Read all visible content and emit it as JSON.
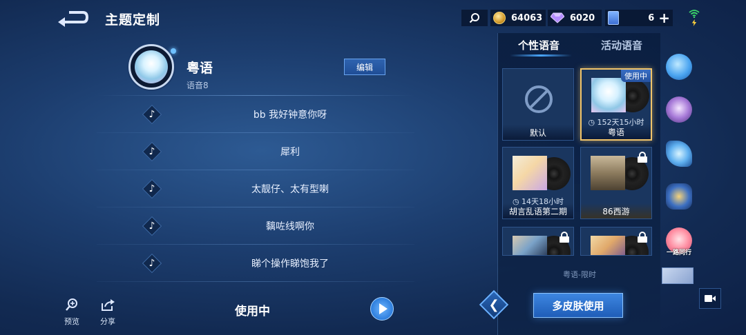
{
  "header": {
    "title": "主题定制"
  },
  "resources": {
    "gold": "64063",
    "gems": "6020",
    "tickets": "6"
  },
  "voice_profile": {
    "name": "粤语",
    "subtitle": "语音8",
    "edit_label": "编辑"
  },
  "voice_lines": [
    {
      "text": "bb 我好钟意你呀"
    },
    {
      "text": "犀利"
    },
    {
      "text": "太靓仔、太有型喇"
    },
    {
      "text": "黐咗线啊你"
    },
    {
      "text": "睇个操作睇饱我了"
    }
  ],
  "bottom_left": {
    "preview_label": "预览",
    "share_label": "分享",
    "status_label": "使用中"
  },
  "tabs": [
    {
      "label": "个性语音",
      "active": true
    },
    {
      "label": "活动语音",
      "active": false
    }
  ],
  "voice_cards": [
    {
      "name": "默认",
      "timer": "",
      "locked": false,
      "selected": false
    },
    {
      "name": "粤语",
      "timer": "152天15小时",
      "locked": false,
      "selected": true,
      "badge": "使用中"
    },
    {
      "name": "胡言乱语第二期",
      "timer": "14天18小时",
      "locked": false,
      "selected": false
    },
    {
      "name": "86西游",
      "timer": "",
      "locked": true,
      "selected": false
    },
    {
      "name": "",
      "timer": "",
      "locked": true,
      "selected": false
    },
    {
      "name": "",
      "timer": "",
      "locked": true,
      "selected": false
    }
  ],
  "card_hint": "粤语-限时",
  "skin_thumbs": [
    {
      "label": ""
    },
    {
      "label": ""
    },
    {
      "label": ""
    },
    {
      "label": ""
    },
    {
      "label": "一路同行"
    }
  ],
  "multi_skin_button": "多皮肤使用",
  "colors": {
    "accent": "#3d86e0",
    "selected_border": "#f2c56a",
    "background": "#1c3d6e"
  }
}
